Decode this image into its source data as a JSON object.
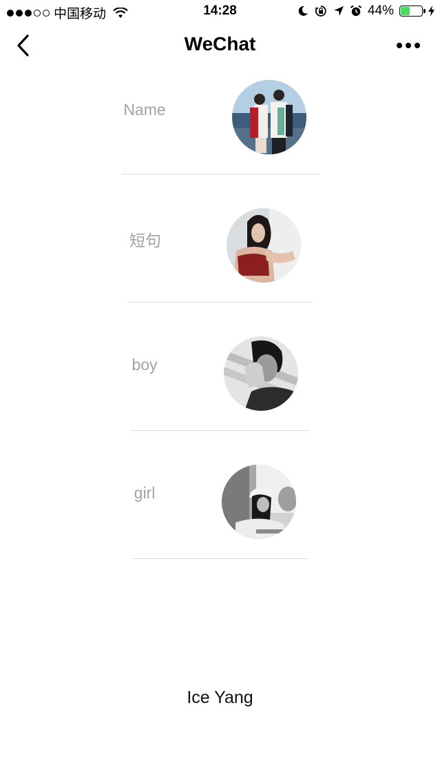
{
  "status_bar": {
    "carrier": "中国移动",
    "time": "14:28",
    "battery": "44%",
    "battery_level": 0.44,
    "icons": [
      "signal-icon",
      "wifi-icon",
      "moon-icon",
      "rotation-lock-icon",
      "location-icon",
      "alarm-icon",
      "battery-icon",
      "charging-icon"
    ]
  },
  "nav": {
    "title": "WeChat",
    "back_icon": "chevron-left-icon",
    "more_icon": "more-dots-icon"
  },
  "items": [
    {
      "label": "Name",
      "avatar": "avatar-couple"
    },
    {
      "label": "短句",
      "avatar": "avatar-woman-red"
    },
    {
      "label": "boy",
      "avatar": "avatar-boy-bw"
    },
    {
      "label": "girl",
      "avatar": "avatar-girl-bw"
    }
  ],
  "footer": {
    "name": "Ice Yang"
  }
}
